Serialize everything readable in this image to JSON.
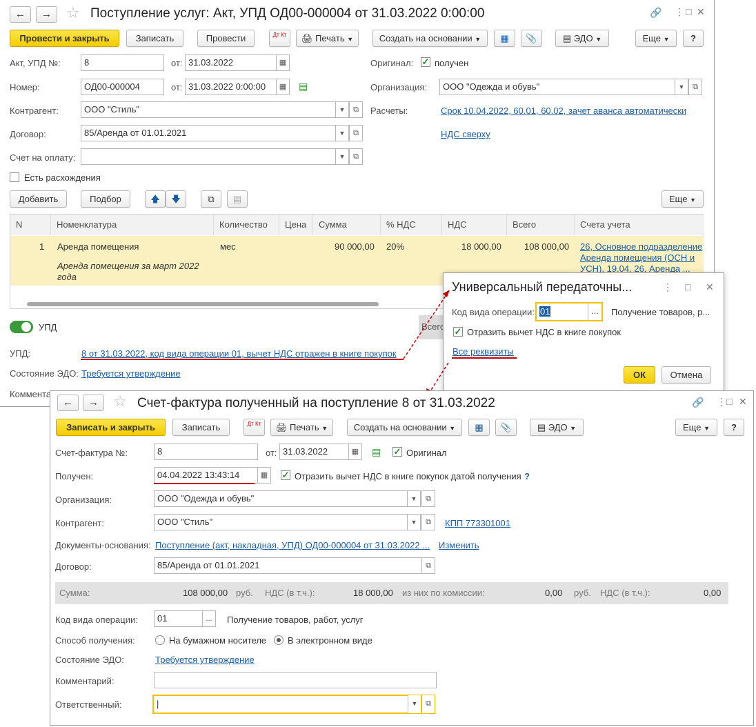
{
  "doc1": {
    "title": "Поступление услуг: Акт, УПД ОД00-000004 от 31.03.2022 0:00:00",
    "toolbar": {
      "post_close": "Провести и закрыть",
      "save": "Записать",
      "post": "Провести",
      "dtkt": "Дт Кт",
      "print": "Печать",
      "create_based": "Создать на основании",
      "edo": "ЭДО",
      "more": "Еще",
      "help": "?"
    },
    "act_label": "Акт, УПД №:",
    "act_value": "8",
    "from_label": "от:",
    "act_date": "31.03.2022",
    "number_label": "Номер:",
    "number_value": "ОД00-000004",
    "number_date": "31.03.2022  0:00:00",
    "original_label": "Оригинал:",
    "original_value": "получен",
    "org_label": "Организация:",
    "org_value": "ООО \"Одежда и обувь\"",
    "contractor_label": "Контрагент:",
    "contractor_value": "ООО \"Стиль\"",
    "settlements_label": "Расчеты:",
    "settlements_link": "Срок 10.04.2022, 60.01, 60.02, зачет аванса автоматически",
    "vat_link": "НДС сверху",
    "contract_label": "Договор:",
    "contract_value": "85/Аренда от 01.01.2021",
    "invoice_label": "Счет на оплату:",
    "invoice_value": "",
    "discrepancy_label": "Есть расхождения",
    "add_btn": "Добавить",
    "select_btn": "Подбор",
    "more_btn": "Еще",
    "columns": [
      "N",
      "Номенклатура",
      "Количество",
      "Цена",
      "Сумма",
      "% НДС",
      "НДС",
      "Всего",
      "Счета учета"
    ],
    "row": {
      "n": "1",
      "item": "Аренда помещения",
      "item_desc": "Аренда помещения за март 2022 года",
      "qty": "мес",
      "price": "",
      "sum": "90 000,00",
      "vat_rate": "20%",
      "vat": "18 000,00",
      "total": "108 000,00",
      "acc1": "26, Основное подразделение",
      "acc2": "Аренда помещения (ОСН и",
      "acc3": "УСН), 19.04, 26, Аренда ..."
    },
    "upd_toggle": "УПД",
    "upd_label": "УПД:",
    "upd_link": "8 от 31.03.2022, код вида операции 01, вычет НДС отражен в книге покупок",
    "edo_label": "Состояние ЭДО:",
    "edo_link": "Требуется утверждение",
    "comment_label": "Комментарий:",
    "total_btn": "Всего"
  },
  "dialog": {
    "title": "Универсальный передаточны...",
    "op_label": "Код вида операции:",
    "op_value": "01",
    "op_desc": "Получение товаров, р...",
    "reflect_label": "Отразить вычет НДС в книге покупок",
    "all_link": "Все реквизиты",
    "ok": "ОК",
    "cancel": "Отмена"
  },
  "doc2": {
    "title": "Счет-фактура полученный на поступление 8 от 31.03.2022",
    "toolbar": {
      "save_close": "Записать и закрыть",
      "save": "Записать",
      "dtkt": "Дт Кт",
      "print": "Печать",
      "create_based": "Создать на основании",
      "edo": "ЭДО",
      "more": "Еще",
      "help": "?"
    },
    "inv_label": "Счет-фактура №:",
    "inv_value": "8",
    "from_label": "от:",
    "inv_date": "31.03.2022",
    "original_label": "Оригинал",
    "received_label": "Получен:",
    "received_value": "04.04.2022 13:43:14",
    "reflect_label": "Отразить вычет НДС в книге покупок датой получения",
    "q": "?",
    "org_label": "Организация:",
    "org_value": "ООО \"Одежда и обувь\"",
    "contractor_label": "Контрагент:",
    "contractor_value": "ООО \"Стиль\"",
    "kpp_link": "КПП 773301001",
    "base_label": "Документы-основания:",
    "base_link": "Поступление (акт, накладная, УПД) ОД00-000004 от 31.03.2022 ...",
    "change_link": "Изменить",
    "contract_label": "Договор:",
    "contract_value": "85/Аренда от 01.01.2021",
    "sum_label": "Сумма:",
    "sum_value": "108 000,00",
    "rub": "руб.",
    "vat_incl_label": "НДС (в т.ч.):",
    "vat_value": "18 000,00",
    "commission_label": "из них по комиссии:",
    "commission_value": "0,00",
    "rub2": "руб.",
    "vat_incl_label2": "НДС (в т.ч.):",
    "commission_vat": "0,00",
    "op_label": "Код вида операции:",
    "op_value": "01",
    "op_desc": "Получение товаров, работ, услуг",
    "method_label": "Способ получения:",
    "paper_label": "На бумажном носителе",
    "electronic_label": "В электронном виде",
    "edo_label": "Состояние ЭДО:",
    "edo_link": "Требуется утверждение",
    "comment_label": "Комментарий:",
    "comment_value": "",
    "resp_label": "Ответственный:",
    "resp_value": "|"
  },
  "colors": {
    "accent_yellow": "#f4cd00",
    "link": "#1b5ea6",
    "red_underline": "#c00000",
    "row_highlight": "#fbf0c0",
    "toggle_green": "#3a9a3a"
  }
}
